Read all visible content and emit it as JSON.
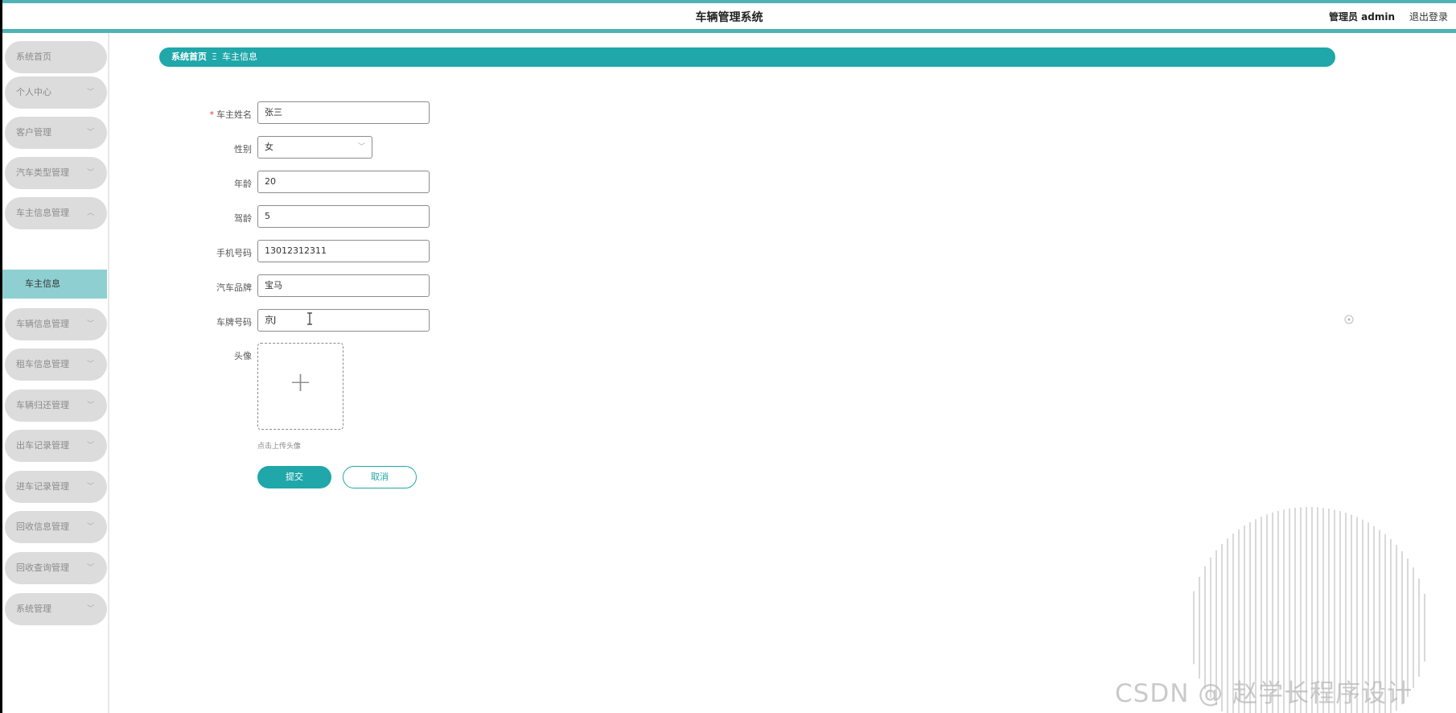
{
  "header": {
    "title": "车辆管理系统",
    "user": "管理员 admin",
    "logout": "退出登录"
  },
  "sidebar": {
    "items": [
      {
        "label": "系统首页"
      },
      {
        "label": "个人中心"
      },
      {
        "label": "客户管理"
      },
      {
        "label": "汽车类型管理"
      },
      {
        "label": "车主信息管理"
      },
      {
        "label": "车辆信息管理"
      },
      {
        "label": "租车信息管理"
      },
      {
        "label": "车辆归还管理"
      },
      {
        "label": "出车记录管理"
      },
      {
        "label": "进车记录管理"
      },
      {
        "label": "回收信息管理"
      },
      {
        "label": "回收查询管理"
      },
      {
        "label": "系统管理"
      }
    ],
    "active_sub": "车主信息"
  },
  "breadcrumb": {
    "home": "系统首页",
    "separator": "Ξ",
    "current": "车主信息"
  },
  "form": {
    "owner_name": {
      "label": "车主姓名",
      "value": "张三"
    },
    "gender": {
      "label": "性别",
      "value": "女"
    },
    "age": {
      "label": "年龄",
      "value": "20"
    },
    "driving_years": {
      "label": "驾龄",
      "value": "5"
    },
    "phone": {
      "label": "手机号码",
      "value": "13012312311"
    },
    "brand": {
      "label": "汽车品牌",
      "value": "宝马"
    },
    "plate": {
      "label": "车牌号码",
      "value": "京J"
    },
    "avatar": {
      "label": "头像",
      "hint": "点击上传头像"
    },
    "submit": "提交",
    "cancel": "取消"
  },
  "watermark": "CSDN @ 赵学长程序设计",
  "colors": {
    "accent": "#1fa7a9",
    "accent_light": "#8ed0d2",
    "top_strip": "#4fb3b6",
    "menu_bg": "#dcdcdc",
    "required": "#e4393c"
  }
}
